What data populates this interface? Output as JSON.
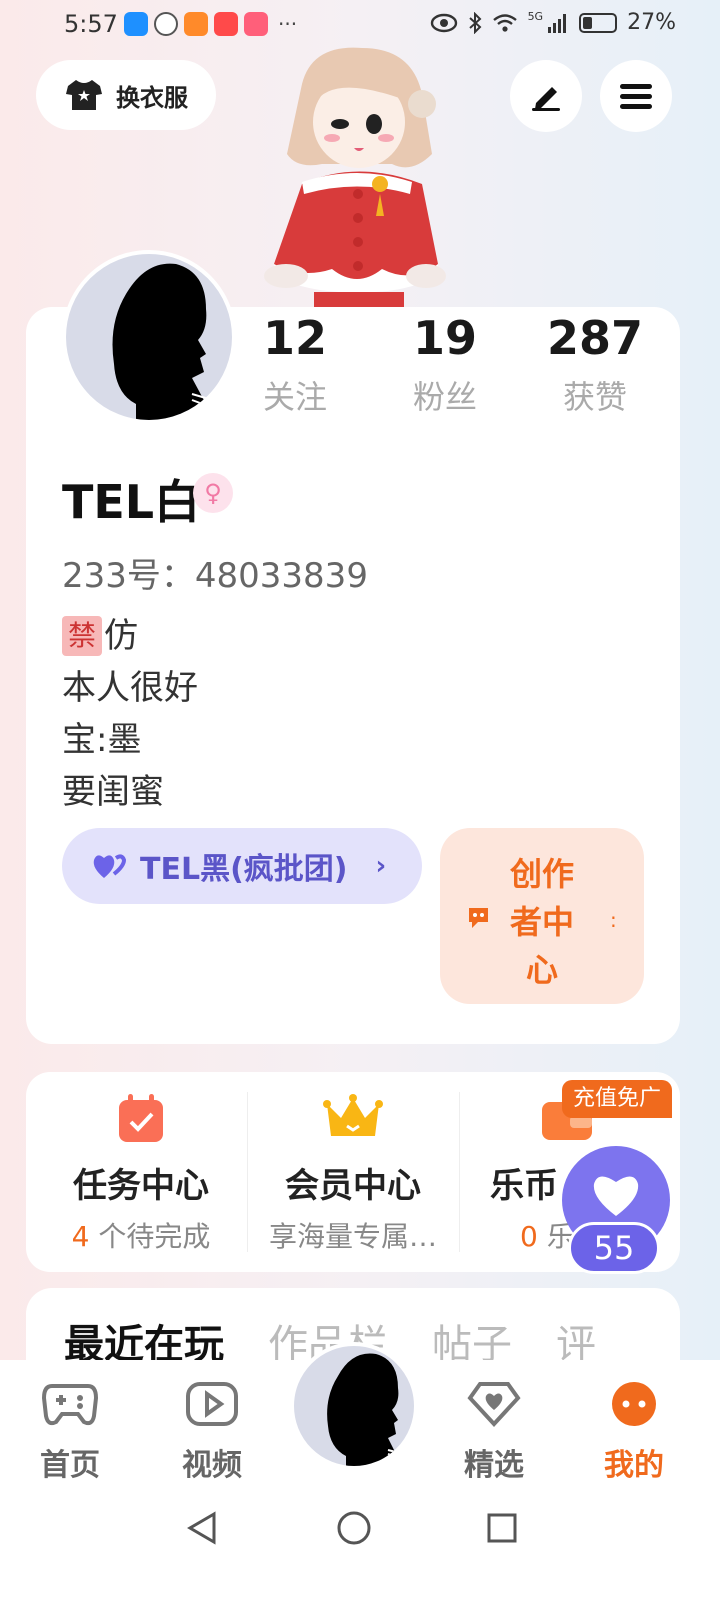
{
  "status_bar": {
    "time": "5:57",
    "app_icons": [
      "weather-icon",
      "wechat-icon",
      "video-app-icon",
      "xiaohongshu-icon",
      "shopping-icon"
    ],
    "more": "···",
    "network": "5G",
    "battery": "27%"
  },
  "header": {
    "wardrobe_label": "换衣服",
    "edit_icon": "pen-icon",
    "menu_icon": "hamburger-icon"
  },
  "profile": {
    "stats": [
      {
        "value": "12",
        "label": "关注"
      },
      {
        "value": "19",
        "label": "粉丝"
      },
      {
        "value": "287",
        "label": "获赞"
      }
    ],
    "nickname": "TEL白",
    "gender_icon": "female-icon",
    "uid": "233号：48033839",
    "bio": {
      "ban_tag": "禁",
      "line1": "仿",
      "line2": "本人很好",
      "line3": "宝:墨",
      "line4": "要闺蜜"
    },
    "group": {
      "label": "TEL黑(疯批团)",
      "chevron": "›"
    },
    "creator": {
      "label": "创作者中心"
    }
  },
  "features": [
    {
      "icon": "calendar-check-icon",
      "title": "任务中心",
      "sub_highlight": "4",
      "sub_text": " 个待完成"
    },
    {
      "icon": "crown-icon",
      "title": "会员中心",
      "sub_highlight": "",
      "sub_text": "享海量专属…"
    },
    {
      "icon": "wallet-icon",
      "title": "乐币",
      "sub_highlight": "0",
      "sub_text": " 乐"
    }
  ],
  "recharge_tag": "充值免广",
  "like_badge": {
    "count": "55"
  },
  "tabs": [
    "最近在玩",
    "作品栏",
    "帖子",
    "评"
  ],
  "bottom_nav": [
    {
      "label": "首页",
      "icon": "gamepad-icon",
      "active": false
    },
    {
      "label": "视频",
      "icon": "play-icon",
      "active": false
    },
    {
      "label": "精选",
      "icon": "heart-diamond-icon",
      "active": false
    },
    {
      "label": "我的",
      "icon": "smiley-icon",
      "active": true
    }
  ],
  "colors": {
    "accent": "#f06a1d",
    "purple": "#6c63e8"
  }
}
